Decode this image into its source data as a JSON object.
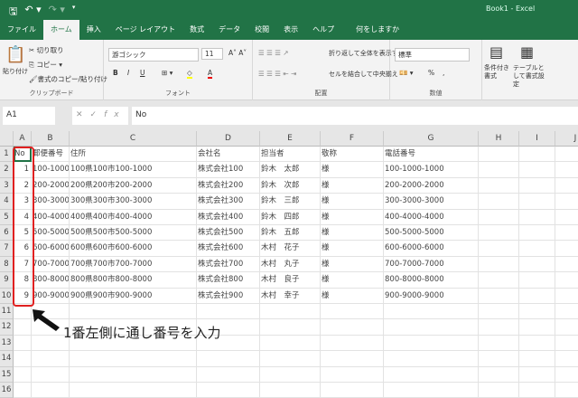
{
  "window": {
    "title": "Book1  -  Excel"
  },
  "qat": {
    "save_icon": "save-icon",
    "undo_icon": "undo-icon",
    "redo_icon": "redo-icon"
  },
  "tabs": [
    "ファイル",
    "ホーム",
    "挿入",
    "ページ レイアウト",
    "数式",
    "データ",
    "校閲",
    "表示",
    "ヘルプ"
  ],
  "active_tab": "ホーム",
  "tell_me": "何をしますか",
  "ribbon": {
    "clipboard": {
      "paste": "貼り付け",
      "cut": "切り取り",
      "copy": "コピー",
      "format_painter": "書式のコピー/貼り付け",
      "label": "クリップボード"
    },
    "font": {
      "name": "游ゴシック",
      "size": "11",
      "bold": "B",
      "italic": "I",
      "underline": "U",
      "label": "フォント"
    },
    "alignment": {
      "wrap": "折り返して全体を表示する",
      "merge": "セルを結合して中央揃え",
      "label": "配置"
    },
    "number": {
      "format": "標準",
      "percent": "%",
      "comma": ",",
      "label": "数値"
    },
    "styles": {
      "conditional": "条件付き書式",
      "table": "テーブルとして書式設定"
    }
  },
  "formula_bar": {
    "name_box": "A1",
    "content": "No",
    "fx": "fx"
  },
  "columns": [
    "A",
    "B",
    "C",
    "D",
    "E",
    "F",
    "G",
    "H",
    "I",
    "J"
  ],
  "rows": [
    "1",
    "2",
    "3",
    "4",
    "5",
    "6",
    "7",
    "8",
    "9",
    "10",
    "11",
    "12",
    "13",
    "14",
    "15",
    "16"
  ],
  "table": {
    "headers": [
      "No",
      "郵便番号",
      "住所",
      "会社名",
      "担当者",
      "敬称",
      "電話番号"
    ],
    "data": [
      [
        "1",
        "100-1000",
        "100県100市100-1000",
        "株式会社100",
        "鈴木　太郎",
        "様",
        "100-1000-1000"
      ],
      [
        "2",
        "200-2000",
        "200県200市200-2000",
        "株式会社200",
        "鈴木　次郎",
        "様",
        "200-2000-2000"
      ],
      [
        "3",
        "300-3000",
        "300県300市300-3000",
        "株式会社300",
        "鈴木　三郎",
        "様",
        "300-3000-3000"
      ],
      [
        "4",
        "400-4000",
        "400県400市400-4000",
        "株式会社400",
        "鈴木　四郎",
        "様",
        "400-4000-4000"
      ],
      [
        "5",
        "500-5000",
        "500県500市500-5000",
        "株式会社500",
        "鈴木　五郎",
        "様",
        "500-5000-5000"
      ],
      [
        "6",
        "600-6000",
        "600県600市600-6000",
        "株式会社600",
        "木村　花子",
        "様",
        "600-6000-6000"
      ],
      [
        "7",
        "700-7000",
        "700県700市700-7000",
        "株式会社700",
        "木村　丸子",
        "様",
        "700-7000-7000"
      ],
      [
        "8",
        "800-8000",
        "800県800市800-8000",
        "株式会社800",
        "木村　良子",
        "様",
        "800-8000-8000"
      ],
      [
        "9",
        "900-9000",
        "900県900市900-9000",
        "株式会社900",
        "木村　幸子",
        "様",
        "900-9000-9000"
      ]
    ]
  },
  "annotation": {
    "text": "1番左側に通し番号を入力",
    "highlight_color": "#e02020"
  },
  "colors": {
    "brand": "#217346"
  }
}
